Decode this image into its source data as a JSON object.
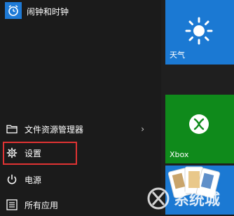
{
  "alarm": {
    "label": "闹钟和时钟",
    "icon": "alarm-clock-icon"
  },
  "menu": {
    "file_explorer": "文件资源管理器",
    "settings": "设置",
    "power": "电源",
    "all_apps": "所有应用"
  },
  "tiles": {
    "weather": "天气",
    "xbox": "Xbox"
  },
  "watermark": {
    "text": "系统城"
  },
  "colors": {
    "accent": "#1b79d3",
    "xbox": "#0f8a1b",
    "highlight": "#e03333"
  }
}
